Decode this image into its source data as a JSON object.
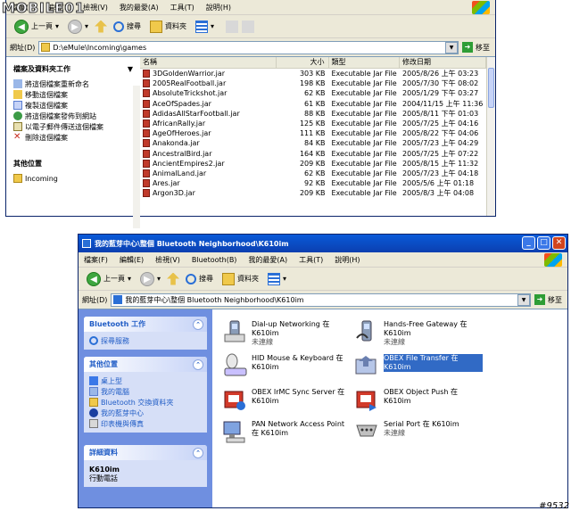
{
  "watermark": {
    "logo": "MOBILE01",
    "code": "#9532"
  },
  "w1": {
    "menu": [
      "檔案(F)",
      "編輯(E)",
      "檢視(V)",
      "我的最愛(A)",
      "工具(T)",
      "說明(H)"
    ],
    "toolbar": {
      "back": "上一頁",
      "search": "搜尋",
      "folders": "資料夾"
    },
    "addr_label": "網址(D)",
    "path": "D:\\eMule\\Incoming\\games",
    "go": "移至",
    "tasks_title": "檔案及資料夾工作",
    "tasks": [
      "將這個檔案重新命名",
      "移動這個檔案",
      "複製這個檔案",
      "將這個檔案發佈到網站",
      "以電子郵件傳送這個檔案",
      "刪除這個檔案"
    ],
    "other_title": "其他位置",
    "other": [
      "Incoming"
    ],
    "cols": [
      "名稱",
      "大小",
      "類型",
      "修改日期"
    ],
    "rows": [
      [
        "3DGoldenWarrior.jar",
        "303 KB",
        "Executable Jar File",
        "2005/8/26 上午 03:23"
      ],
      [
        "2005RealFootball.jar",
        "198 KB",
        "Executable Jar File",
        "2005/7/30 下午 08:02"
      ],
      [
        "AbsoluteTrickshot.jar",
        "62 KB",
        "Executable Jar File",
        "2005/1/29 下午 03:27"
      ],
      [
        "AceOfSpades.jar",
        "61 KB",
        "Executable Jar File",
        "2004/11/15 上午 11:36"
      ],
      [
        "AdidasAllStarFootball.jar",
        "88 KB",
        "Executable Jar File",
        "2005/8/11 下午 01:03"
      ],
      [
        "AfricanRally.jar",
        "125 KB",
        "Executable Jar File",
        "2005/7/25 上午 04:16"
      ],
      [
        "AgeOfHeroes.jar",
        "111 KB",
        "Executable Jar File",
        "2005/8/22 下午 04:06"
      ],
      [
        "Anakonda.jar",
        "84 KB",
        "Executable Jar File",
        "2005/7/23 上午 04:29"
      ],
      [
        "AncestralBird.jar",
        "164 KB",
        "Executable Jar File",
        "2005/7/25 上午 07:22"
      ],
      [
        "AncientEmpires2.jar",
        "209 KB",
        "Executable Jar File",
        "2005/8/15 上午 11:32"
      ],
      [
        "AnimalLand.jar",
        "62 KB",
        "Executable Jar File",
        "2005/7/23 上午 04:18"
      ],
      [
        "Ares.jar",
        "92 KB",
        "Executable Jar File",
        "2005/5/6 上午 01:18"
      ],
      [
        "Argon3D.jar",
        "209 KB",
        "Executable Jar File",
        "2005/8/3 上午 04:08"
      ]
    ]
  },
  "w2": {
    "title": "我的藍芽中心\\整個 Bluetooth Neighborhood\\K610im",
    "menu": [
      "檔案(F)",
      "編輯(E)",
      "檢視(V)",
      "Bluetooth(B)",
      "我的最愛(A)",
      "工具(T)",
      "說明(H)"
    ],
    "toolbar": {
      "back": "上一頁",
      "search": "搜尋",
      "folders": "資料夾"
    },
    "addr_label": "網址(D)",
    "path": "我的藍芽中心\\整個 Bluetooth Neighborhood\\K610im",
    "go": "移至",
    "bt_title": "Bluetooth 工作",
    "bt_items": [
      "探尋服務"
    ],
    "other_title": "其他位置",
    "other": [
      "桌上型",
      "我的電腦",
      "Bluetooth 交換資料夾",
      "我的藍芽中心",
      "印表機與傳真"
    ],
    "detail_title": "詳細資料",
    "detail_name": "K610im",
    "detail_type": "行動電話",
    "services": [
      {
        "name": "Dial-up Networking 在 K610im",
        "sub": "未連線"
      },
      {
        "name": "Hands-Free Gateway 在 K610im",
        "sub": "未連線"
      },
      {
        "name": "HID Mouse & Keyboard 在 K610im",
        "sub": ""
      },
      {
        "name": "OBEX File Transfer 在 K610im",
        "sub": ""
      },
      {
        "name": "OBEX IrMC Sync Server 在 K610im",
        "sub": ""
      },
      {
        "name": "OBEX Object Push 在 K610im",
        "sub": ""
      },
      {
        "name": "PAN Network Access Point 在 K610im",
        "sub": ""
      },
      {
        "name": "Serial Port 在 K610im",
        "sub": "未連線"
      }
    ]
  }
}
